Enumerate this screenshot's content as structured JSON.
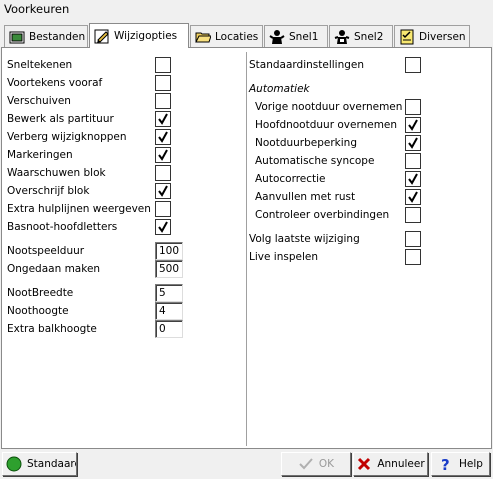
{
  "window": {
    "title": "Voorkeuren"
  },
  "tabs": [
    {
      "label": "Bestanden",
      "icon": "folder-tab-icon"
    },
    {
      "label": "Wijzigopties",
      "icon": "pencil-edit-icon"
    },
    {
      "label": "Locaties",
      "icon": "folder-open-icon"
    },
    {
      "label": "Snel1",
      "icon": "person-speed-icon"
    },
    {
      "label": "Snel2",
      "icon": "person-speed2-icon"
    },
    {
      "label": "Diversen",
      "icon": "checklist-icon"
    }
  ],
  "active_tab": "Wijzigopties",
  "left_options": [
    {
      "label": "Sneltekenen",
      "checked": false
    },
    {
      "label": "Voortekens vooraf",
      "checked": false
    },
    {
      "label": "Verschuiven",
      "checked": false
    },
    {
      "label": "Bewerk als partituur",
      "checked": true
    },
    {
      "label": "Verberg wijzigknoppen",
      "checked": true
    },
    {
      "label": "Markeringen",
      "checked": true
    },
    {
      "label": "Waarschuwen blok",
      "checked": false
    },
    {
      "label": "Overschrijf blok",
      "checked": true
    },
    {
      "label": "Extra hulplijnen weergeven",
      "checked": false
    },
    {
      "label": "Basnoot-hoofdletters",
      "checked": true
    }
  ],
  "timing_fields": [
    {
      "label": "Nootspeelduur",
      "value": "100"
    },
    {
      "label": "Ongedaan maken",
      "value": "500"
    }
  ],
  "size_fields": [
    {
      "label": "NootBreedte",
      "value": "5"
    },
    {
      "label": "Noothoogte",
      "value": "4"
    },
    {
      "label": "Extra balkhoogte",
      "value": "0"
    }
  ],
  "right": {
    "defaults": {
      "label": "Standaardinstellingen",
      "checked": false
    },
    "group_title": "Automatiek",
    "auto_options": [
      {
        "label": "Vorige nootduur overnemen",
        "checked": false
      },
      {
        "label": "Hoofdnootduur overnemen",
        "checked": true
      },
      {
        "label": "Nootduurbeperking",
        "checked": true
      },
      {
        "label": "Automatische syncope",
        "checked": false
      },
      {
        "label": "Autocorrectie",
        "checked": true
      },
      {
        "label": "Aanvullen met rust",
        "checked": true
      },
      {
        "label": "Controleer overbindingen",
        "checked": false
      }
    ],
    "extra_options": [
      {
        "label": "Volg laatste wijziging",
        "checked": false
      },
      {
        "label": "Live inspelen",
        "checked": false
      }
    ]
  },
  "buttons": {
    "standard": "Standaard",
    "ok": "OK",
    "cancel": "Annuleer",
    "help": "Help"
  },
  "colors": {
    "check": "#000000",
    "ok_green": "#2e8b2e",
    "cancel_red": "#c00000",
    "help_blue": "#1a3cc8"
  }
}
